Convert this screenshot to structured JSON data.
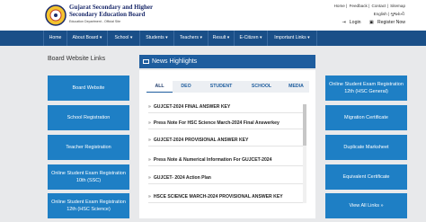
{
  "header": {
    "org_name_line1": "Gujarat Secondary and Higher",
    "org_name_line2": "Secondary Education Board",
    "org_sub": "Education Department - Official Site",
    "top_links": [
      "Home",
      "Feedback",
      "Contact",
      "Sitemap"
    ],
    "lang_links": [
      "English",
      "ગુજરાતી"
    ],
    "login_label": "Login",
    "register_label": "Register Now"
  },
  "nav": [
    "Home",
    "About Board ▾",
    "School ▾",
    "Students ▾",
    "Teachers ▾",
    "Result ▾",
    "E-Citizen ▾",
    "Important Links ▾"
  ],
  "left": {
    "title": "Board Website Links",
    "buttons": [
      "Board Website",
      "School Registration",
      "Teacher Registration",
      "Online Student Exam Registration 10th (SSC)",
      "Online Student Exam Registration 12th (HSC Science)"
    ]
  },
  "news": {
    "title": "News Highlights",
    "tabs": [
      "ALL",
      "DEO",
      "STUDENT",
      "SCHOOL",
      "MEDIA"
    ],
    "items": [
      "GUJCET-2024 FINAL ANSWER KEY",
      "Press Note For HSC Science March-2024 Final Answerkey",
      "GUJCET-2024 PROVISIONAL ANSWER KEY",
      "Press Note & Numerical Information For GUJCET-2024",
      "GUJCET- 2024 Action Plan",
      "HSCE SCIENCE MARCH-2024 PROVISIONAL ANSWER KEY"
    ]
  },
  "right": {
    "buttons": [
      "Online Student Exam Registration 12th (HSC General)",
      "Migration Certificate",
      "Duplicate Marksheet",
      "Equivalent Certificate",
      "View All Links »"
    ]
  }
}
